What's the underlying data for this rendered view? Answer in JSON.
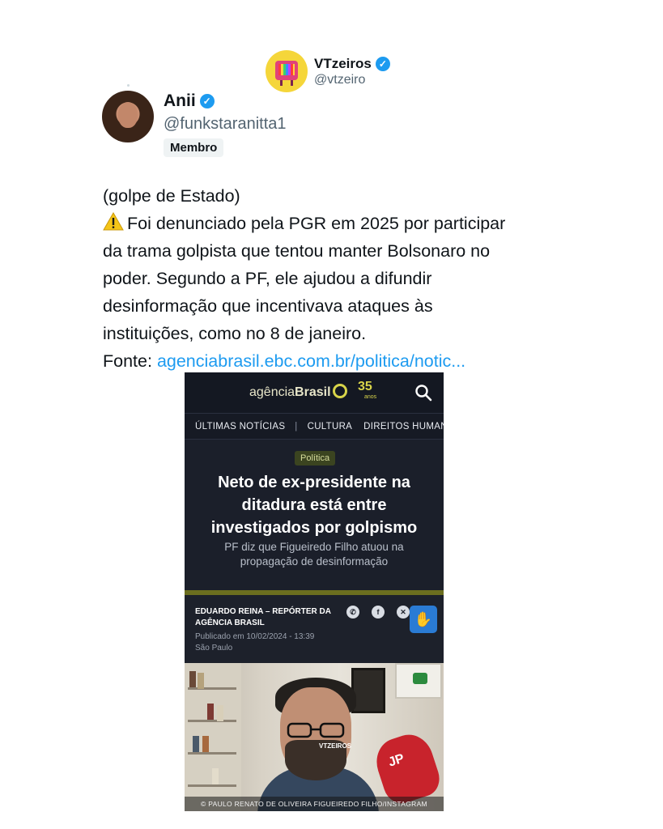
{
  "watermark": {
    "name": "VTzeiros",
    "handle": "@vtzeiro"
  },
  "author": {
    "name": "Anii",
    "handle": "@funkstaranitta1",
    "badge": "Membro"
  },
  "tweet": {
    "lines": [
      "(golpe de Estado)",
      "Foi denunciado pela PGR em 2025 por participar",
      "da trama golpista que tentou manter Bolsonaro no",
      "poder. Segundo a PF, ele ajudou a difundir",
      "desinformação que incentivava ataques às",
      "instituições, como no 8 de janeiro."
    ],
    "warning_icon": "warning-emoji",
    "source_label": "Fonte: ",
    "source_link": "agenciabrasil.ebc.com.br/politica/notic..."
  },
  "article": {
    "logo_light": "agência",
    "logo_bold": "Brasil",
    "anniversary": "35",
    "anniversary_sub": "anos",
    "nav": [
      "ÚLTIMAS NOTÍCIAS",
      "CULTURA",
      "DIREITOS HUMANOS"
    ],
    "category": "Política",
    "headline_lines": [
      "Neto de ex-presidente na",
      "ditadura está entre",
      "investigados por golpismo"
    ],
    "subhead_lines": [
      "PF diz que Figueiredo Filho atuou na",
      "propagação de desinformação"
    ],
    "author_lines": [
      "EDUARDO REINA – REPÓRTER DA",
      "AGÊNCIA BRASIL"
    ],
    "published": "Publicado em 10/02/2024 - 13:39",
    "location": "São Paulo",
    "share_icons": [
      "whatsapp-icon",
      "facebook-icon",
      "x-icon",
      "linkedin-icon"
    ],
    "photo_watermark": "VTZEIROS",
    "mic_logo": "JP",
    "photo_credit": "© PAULO RENATO DE OLIVEIRA FIGUEIREDO FILHO/INSTAGRAM"
  },
  "colors": {
    "link": "#1d9bf0",
    "verified": "#1d9bf0",
    "article_bg": "#1b1f2a",
    "article_accent": "#d8d44a"
  }
}
